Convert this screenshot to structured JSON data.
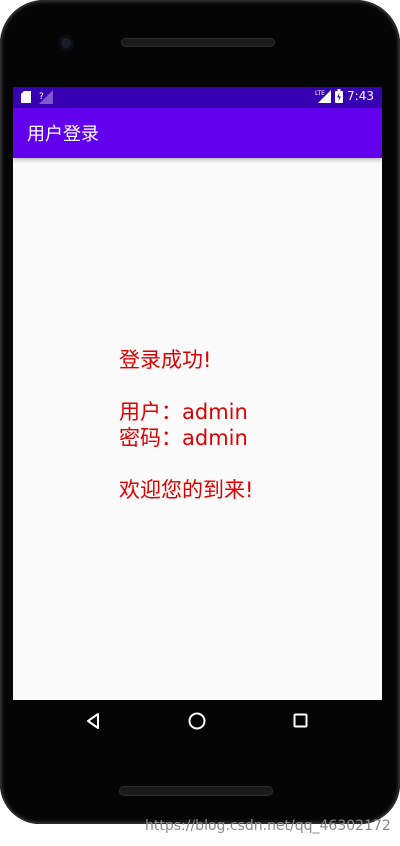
{
  "status_bar": {
    "time": "7:43",
    "network": "LTE",
    "icons": [
      "sd-card-icon",
      "signal-unknown-icon",
      "lte-signal-icon",
      "battery-icon"
    ]
  },
  "app_bar": {
    "title": "用户登录"
  },
  "message": {
    "success": "登录成功!",
    "user_line": "用户：admin",
    "password_line": "密码：admin",
    "welcome": "欢迎您的到来!"
  },
  "nav_bar": {
    "icons": [
      "back-icon",
      "home-icon",
      "recents-icon"
    ]
  },
  "watermark": "https://blog.csdn.net/qq_46302172",
  "colors": {
    "status_bar": "#3700b3",
    "app_bar": "#6200ee",
    "message_text": "#e00000",
    "screen_bg": "#fafafa"
  }
}
